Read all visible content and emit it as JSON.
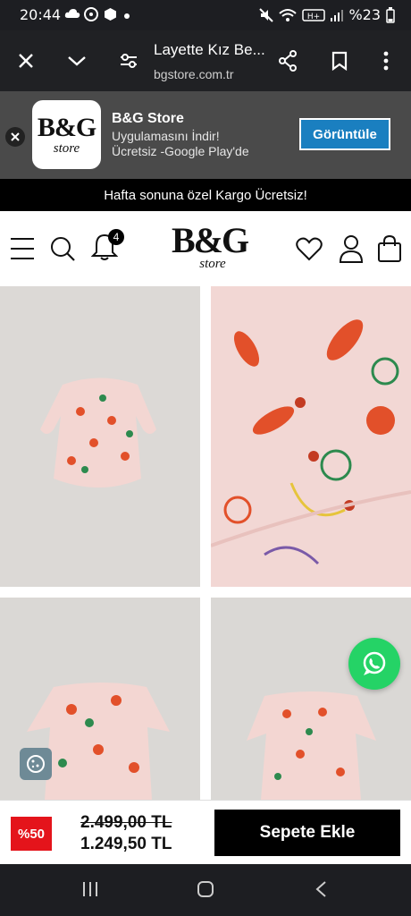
{
  "status_bar": {
    "time": "20:44",
    "battery": "%23"
  },
  "browser": {
    "title": "Layette Kız Be...",
    "url": "bgstore.com.tr"
  },
  "app_banner": {
    "logo_main": "B&G",
    "logo_sub": "store",
    "name": "B&G Store",
    "line1": "Uygulamasını İndir!",
    "line2": "Ücretsiz -Google Play'de",
    "button": "Görüntüle"
  },
  "promo": {
    "text": "Hafta sonuna özel Kargo Ücretsiz!"
  },
  "header": {
    "cart_count": "4",
    "logo_main": "B&G",
    "logo_sub": "store"
  },
  "product": {
    "discount": "%50",
    "old_price": "2.499,00 TL",
    "new_price": "1.249,50 TL",
    "add_to_cart": "Sepete Ekle"
  },
  "colors": {
    "accent_red": "#e4141b",
    "banner_button": "#1a7fc0",
    "whatsapp": "#25d366"
  },
  "icons": [
    "close-icon",
    "chevron-down-icon",
    "tune-icon",
    "share-icon",
    "bookmark-icon",
    "more-icon",
    "menu-icon",
    "search-icon",
    "bell-icon",
    "heart-icon",
    "user-icon",
    "bag-icon",
    "whatsapp-icon",
    "cookie-icon"
  ]
}
